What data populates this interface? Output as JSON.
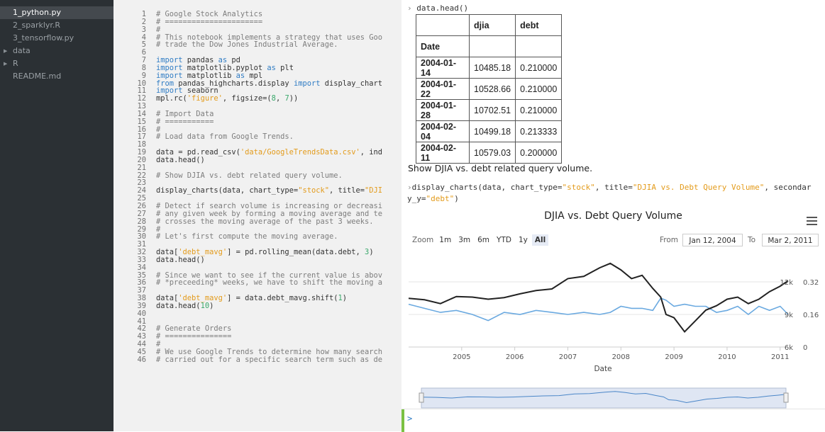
{
  "sidebar": {
    "items": [
      {
        "label": "1_python.py",
        "folder": false,
        "active": true
      },
      {
        "label": "2_sparklyr.R",
        "folder": false,
        "active": false
      },
      {
        "label": "3_tensorflow.py",
        "folder": false,
        "active": false
      },
      {
        "label": "data",
        "folder": true,
        "active": false
      },
      {
        "label": "R",
        "folder": true,
        "active": false
      },
      {
        "label": "README.md",
        "folder": false,
        "active": false
      }
    ]
  },
  "editor": {
    "lines": [
      [
        [
          "c",
          "# Google Stock Analytics"
        ]
      ],
      [
        [
          "c",
          "# ======================"
        ]
      ],
      [
        [
          "c",
          "#"
        ]
      ],
      [
        [
          "c",
          "# This notebook implements a strategy that uses Goo"
        ]
      ],
      [
        [
          "c",
          "# trade the Dow Jones Industrial Average."
        ]
      ],
      [],
      [
        [
          "k",
          "import"
        ],
        [
          "p",
          " pandas "
        ],
        [
          "k",
          "as"
        ],
        [
          "p",
          " pd"
        ]
      ],
      [
        [
          "k",
          "import"
        ],
        [
          "p",
          " matplotlib.pyplot "
        ],
        [
          "k",
          "as"
        ],
        [
          "p",
          " plt"
        ]
      ],
      [
        [
          "k",
          "import"
        ],
        [
          "p",
          " matplotlib "
        ],
        [
          "k",
          "as"
        ],
        [
          "p",
          " mpl"
        ]
      ],
      [
        [
          "k",
          "from"
        ],
        [
          "p",
          " pandas_highcharts.display "
        ],
        [
          "k",
          "import"
        ],
        [
          "p",
          " display_chart"
        ]
      ],
      [
        [
          "k",
          "import"
        ],
        [
          "p",
          " seaborn"
        ]
      ],
      [
        [
          "p",
          "mpl.rc("
        ],
        [
          "s",
          "'figure'"
        ],
        [
          "p",
          ", figsize=("
        ],
        [
          "n",
          "8"
        ],
        [
          "p",
          ", "
        ],
        [
          "n",
          "7"
        ],
        [
          "p",
          "))"
        ]
      ],
      [],
      [
        [
          "c",
          "# Import Data"
        ]
      ],
      [
        [
          "c",
          "# ==========="
        ]
      ],
      [
        [
          "c",
          "#"
        ]
      ],
      [
        [
          "c",
          "# Load data from Google Trends."
        ]
      ],
      [],
      [
        [
          "p",
          "data = pd.read_csv("
        ],
        [
          "s",
          "'data/GoogleTrendsData.csv'"
        ],
        [
          "p",
          ", ind"
        ]
      ],
      [
        [
          "p",
          "data.head()"
        ]
      ],
      [],
      [
        [
          "c",
          "# Show DJIA vs. debt related query volume."
        ]
      ],
      [],
      [
        [
          "p",
          "display_charts(data, chart_type="
        ],
        [
          "s",
          "\"stock\""
        ],
        [
          "p",
          ", title="
        ],
        [
          "s",
          "\"DJI"
        ]
      ],
      [],
      [
        [
          "c",
          "# Detect if search volume is increasing or decreasi"
        ]
      ],
      [
        [
          "c",
          "# any given week by forming a moving average and te"
        ]
      ],
      [
        [
          "c",
          "# crosses the moving average of the past 3 weeks."
        ]
      ],
      [
        [
          "c",
          "#"
        ]
      ],
      [
        [
          "c",
          "# Let's first compute the moving average."
        ]
      ],
      [],
      [
        [
          "p",
          "data["
        ],
        [
          "s",
          "'debt_mavg'"
        ],
        [
          "p",
          "] = pd.rolling_mean(data.debt, "
        ],
        [
          "n",
          "3"
        ],
        [
          "p",
          ")"
        ]
      ],
      [
        [
          "p",
          "data.head()"
        ]
      ],
      [],
      [
        [
          "c",
          "# Since we want to see if the current value is abov"
        ]
      ],
      [
        [
          "c",
          "# *preceeding* weeks, we have to shift the moving a"
        ]
      ],
      [],
      [
        [
          "p",
          "data["
        ],
        [
          "s",
          "'debt_mavg'"
        ],
        [
          "p",
          "] = data.debt_mavg.shift("
        ],
        [
          "n",
          "1"
        ],
        [
          "p",
          ")"
        ]
      ],
      [
        [
          "p",
          "data.head("
        ],
        [
          "n",
          "10"
        ],
        [
          "p",
          ")"
        ]
      ],
      [],
      [],
      [
        [
          "c",
          "# Generate Orders"
        ]
      ],
      [
        [
          "c",
          "# ==============="
        ]
      ],
      [
        [
          "c",
          "#"
        ]
      ],
      [
        [
          "c",
          "# We use Google Trends to determine how many search"
        ]
      ],
      [
        [
          "c",
          "# carried out for a specific search term such as de"
        ]
      ]
    ]
  },
  "console": {
    "cmd1": "data.head()",
    "table": {
      "columns": [
        "",
        "djia",
        "debt"
      ],
      "index_name": "Date",
      "rows": [
        [
          "2004-01-14",
          "10485.18",
          "0.210000"
        ],
        [
          "2004-01-22",
          "10528.66",
          "0.210000"
        ],
        [
          "2004-01-28",
          "10702.51",
          "0.210000"
        ],
        [
          "2004-02-04",
          "10499.18",
          "0.213333"
        ],
        [
          "2004-02-11",
          "10579.03",
          "0.200000"
        ]
      ]
    },
    "caption": "Show DJIA vs. debt related query volume.",
    "cmd2_line1": "display_charts(data, chart_type=\"stock\", title=\"DJIA vs. Debt Query Volume\", secondar",
    "cmd2_line2": "y_y=\"debt\")",
    "cmd2_parts": {
      "a": "display_charts(data, chart_type=",
      "b": "\"stock\"",
      "c": ", title=",
      "d": "\"DJIA vs. Debt Query Volume\"",
      "e": ", secondar",
      "f": "y_y=",
      "g": "\"debt\"",
      "h": ")"
    },
    "prompt_symbol": ">"
  },
  "colors": {
    "sidebar_bg": "#2b3034",
    "editor_bg": "#f1f1f1",
    "djia_line": "#222222",
    "debt_line": "#6aa9e0",
    "navigator_fill": "#dfe6f3",
    "prompt_green": "#7ac143"
  },
  "chart_data": {
    "type": "line",
    "title": "DJIA vs. Debt Query Volume",
    "xlabel": "Date",
    "x_ticks": [
      "2005",
      "2006",
      "2007",
      "2008",
      "2009",
      "2010",
      "2011"
    ],
    "y_ticks_left": [
      "12k",
      "9k",
      "6k"
    ],
    "y_ticks_right": [
      "0.32",
      "0.16",
      "0"
    ],
    "ylim_left": [
      6000,
      12000
    ],
    "ylim_right": [
      0,
      0.32
    ],
    "zoom": {
      "label": "Zoom",
      "buttons": [
        "1m",
        "3m",
        "6m",
        "YTD",
        "1y",
        "All"
      ],
      "active": "All"
    },
    "range": {
      "from_label": "From",
      "from": "Jan 12, 2004",
      "to_label": "To",
      "to": "Mar 2, 2011"
    },
    "series": [
      {
        "name": "djia",
        "axis": "left",
        "x": [
          2004.0,
          2004.3,
          2004.6,
          2004.9,
          2005.2,
          2005.5,
          2005.8,
          2006.1,
          2006.4,
          2006.7,
          2007.0,
          2007.3,
          2007.6,
          2007.8,
          2008.0,
          2008.2,
          2008.4,
          2008.6,
          2008.75,
          2008.85,
          2009.0,
          2009.2,
          2009.4,
          2009.6,
          2009.8,
          2010.0,
          2010.2,
          2010.4,
          2010.6,
          2010.8,
          2011.0,
          2011.15
        ],
        "y": [
          10480,
          10350,
          10000,
          10650,
          10600,
          10400,
          10550,
          10900,
          11200,
          11350,
          12300,
          12500,
          13300,
          13700,
          13100,
          12300,
          12600,
          11400,
          10600,
          9000,
          8700,
          7400,
          8400,
          9400,
          9800,
          10400,
          10600,
          10000,
          10400,
          11100,
          11600,
          12100
        ]
      },
      {
        "name": "debt",
        "axis": "right",
        "x": [
          2004.0,
          2004.3,
          2004.6,
          2004.9,
          2005.2,
          2005.5,
          2005.8,
          2006.1,
          2006.4,
          2006.7,
          2007.0,
          2007.3,
          2007.6,
          2007.8,
          2008.0,
          2008.2,
          2008.4,
          2008.6,
          2008.75,
          2008.85,
          2009.0,
          2009.2,
          2009.4,
          2009.6,
          2009.8,
          2010.0,
          2010.2,
          2010.4,
          2010.6,
          2010.8,
          2011.0,
          2011.15
        ],
        "y": [
          0.21,
          0.19,
          0.17,
          0.18,
          0.16,
          0.13,
          0.17,
          0.16,
          0.18,
          0.17,
          0.16,
          0.17,
          0.16,
          0.17,
          0.2,
          0.19,
          0.19,
          0.18,
          0.24,
          0.23,
          0.2,
          0.21,
          0.2,
          0.2,
          0.17,
          0.18,
          0.2,
          0.16,
          0.2,
          0.18,
          0.2,
          0.16
        ]
      }
    ]
  }
}
